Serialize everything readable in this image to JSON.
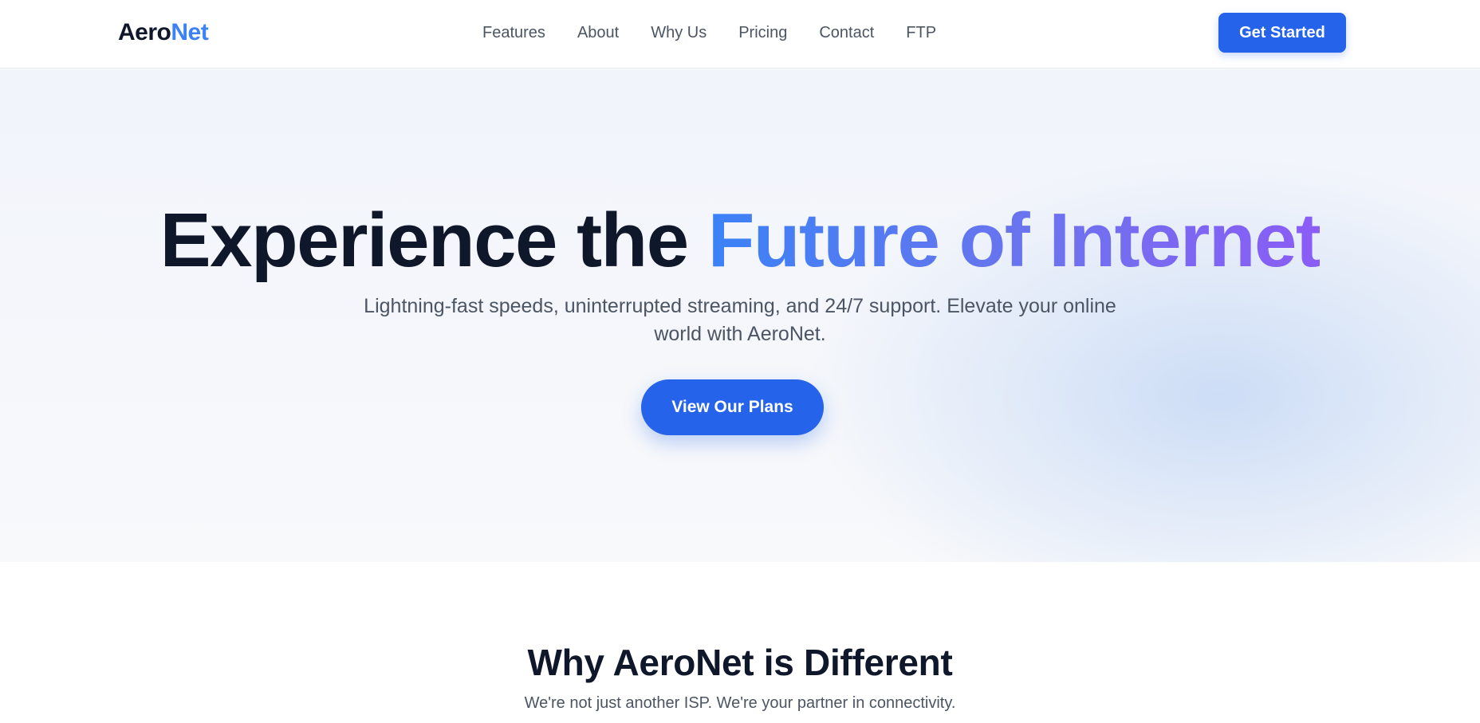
{
  "brand": {
    "name_part1": "Aero",
    "name_part2": "Net",
    "accent_color": "#3b82f6"
  },
  "nav": {
    "items": [
      {
        "label": "Features"
      },
      {
        "label": "About"
      },
      {
        "label": "Why Us"
      },
      {
        "label": "Pricing"
      },
      {
        "label": "Contact"
      },
      {
        "label": "FTP"
      }
    ],
    "cta_label": "Get Started"
  },
  "hero": {
    "title_plain": "Experience the ",
    "title_accent": "Future of Internet",
    "subtitle": "Lightning-fast speeds, uninterrupted streaming, and 24/7 support. Elevate your online world with AeroNet.",
    "button_label": "View Our Plans"
  },
  "why": {
    "title": "Why AeroNet is Different",
    "subtitle": "We're not just another ISP. We're your partner in connectivity."
  },
  "colors": {
    "primary": "#2563eb",
    "heading": "#0f172a",
    "body_text": "#4b5563",
    "gradient_start": "#3b82f6",
    "gradient_end": "#8b5cf6"
  }
}
